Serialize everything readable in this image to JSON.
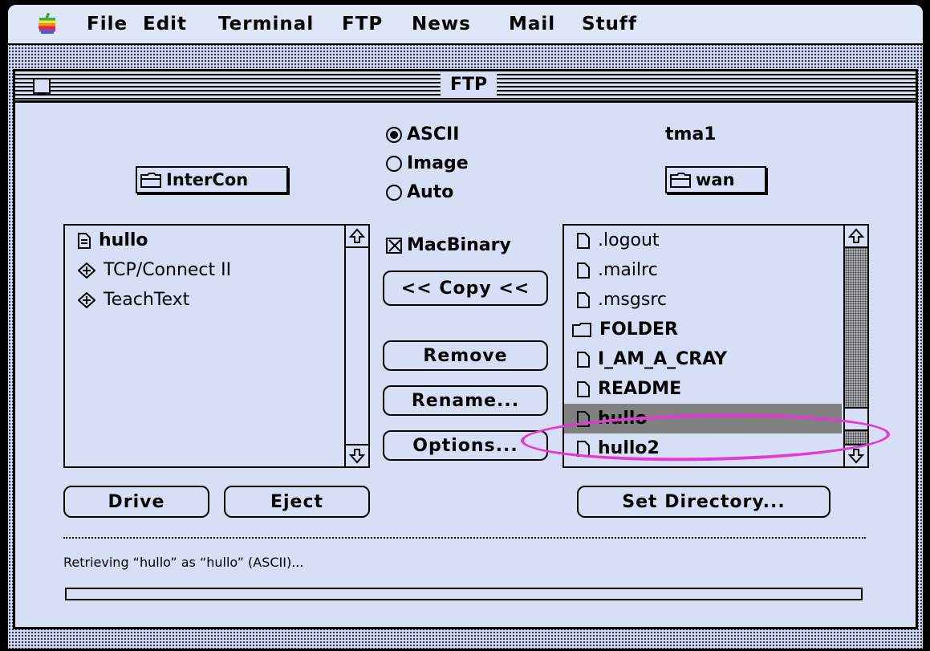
{
  "menubar": {
    "items": [
      "File",
      "Edit",
      "Terminal",
      "FTP",
      "News",
      "Mail",
      "Stuff"
    ]
  },
  "window": {
    "title": "FTP"
  },
  "local": {
    "folder_button": "InterCon",
    "files": [
      {
        "name": "hullo",
        "icon": "document-icon"
      },
      {
        "name": "TCP/Connect II",
        "icon": "application-icon"
      },
      {
        "name": "TeachText",
        "icon": "application-icon"
      }
    ],
    "drive_button": "Drive",
    "eject_button": "Eject"
  },
  "transfer": {
    "modes": [
      {
        "label": "ASCII",
        "selected": true
      },
      {
        "label": "Image",
        "selected": false
      },
      {
        "label": "Auto",
        "selected": false
      }
    ],
    "macbinary_label": "MacBinary",
    "macbinary_checked": true,
    "copy_button": "<< Copy <<",
    "remove_button": "Remove",
    "rename_button": "Rename...",
    "options_button": "Options..."
  },
  "remote": {
    "host": "tma1",
    "folder_button": "wan",
    "files": [
      {
        "name": ".logout",
        "icon": "document-icon",
        "selected": false
      },
      {
        "name": ".mailrc",
        "icon": "document-icon",
        "selected": false
      },
      {
        "name": ".msgsrc",
        "icon": "document-icon",
        "selected": false
      },
      {
        "name": "FOLDER",
        "icon": "folder-icon",
        "selected": false
      },
      {
        "name": "I_AM_A_CRAY",
        "icon": "document-icon",
        "selected": false
      },
      {
        "name": "README",
        "icon": "document-icon",
        "selected": false
      },
      {
        "name": "hullo",
        "icon": "document-icon",
        "selected": true
      },
      {
        "name": "hullo2",
        "icon": "document-icon",
        "selected": false
      }
    ],
    "set_directory_button": "Set Directory..."
  },
  "status": {
    "message": "Retrieving “hullo” as “hullo” (ASCII)...",
    "progress": 0
  },
  "colors": {
    "desktop": "#cfd8f0",
    "window": "#d6dff5",
    "selection": "#808080",
    "annotation": "#e33ad6"
  }
}
